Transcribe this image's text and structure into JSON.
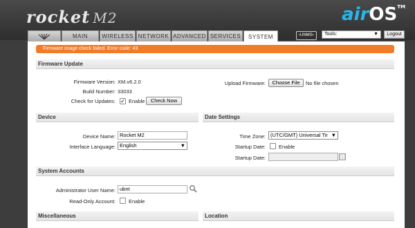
{
  "header": {
    "brand": "rocket",
    "model": "M2",
    "airos_air": "air",
    "airos_os": "OS",
    "airos_tm": "TM"
  },
  "tabs": [
    {
      "label": "MAIN"
    },
    {
      "label": "WIRELESS"
    },
    {
      "label": "NETWORK"
    },
    {
      "label": "ADVANCED"
    },
    {
      "label": "SERVICES"
    },
    {
      "label": "SYSTEM",
      "active": true
    }
  ],
  "toolbar": {
    "unms_badge": "UNMS",
    "tools_select": "Tools:",
    "logout_label": "Logout"
  },
  "alert": {
    "text": "Firmware image check failed. Error code: 43"
  },
  "firmware": {
    "title": "Firmware Update",
    "version_label": "Firmware Version:",
    "version_value": "XM.v6.2.0",
    "build_label": "Build Number:",
    "build_value": "33033",
    "check_label": "Check for Updates:",
    "enable_label": "Enable",
    "check_now_label": "Check Now",
    "upload_label": "Upload Firmware:",
    "choose_file_label": "Choose File",
    "no_file_text": "No file chosen"
  },
  "device": {
    "title": "Device",
    "name_label": "Device Name:",
    "name_value": "Rocket M2",
    "language_label": "Interface Language:",
    "language_value": "English"
  },
  "date_settings": {
    "title": "Date Settings",
    "timezone_label": "Time Zone:",
    "timezone_value": "(UTC/GMT) Universal Tir",
    "startup_date_label": "Startup Date:",
    "enable_label": "Enable",
    "startup_date_field_label": "Startup Date:",
    "startup_date_value": ""
  },
  "accounts": {
    "title": "System Accounts",
    "admin_label": "Administrator User Name:",
    "admin_value": "ubnt",
    "readonly_label": "Read-Only Account:",
    "enable_label": "Enable"
  },
  "misc": {
    "title": "Miscellaneous"
  },
  "location": {
    "title": "Location"
  },
  "colors": {
    "accent": "#f07c2a",
    "brand_blue": "#29b6e8"
  }
}
